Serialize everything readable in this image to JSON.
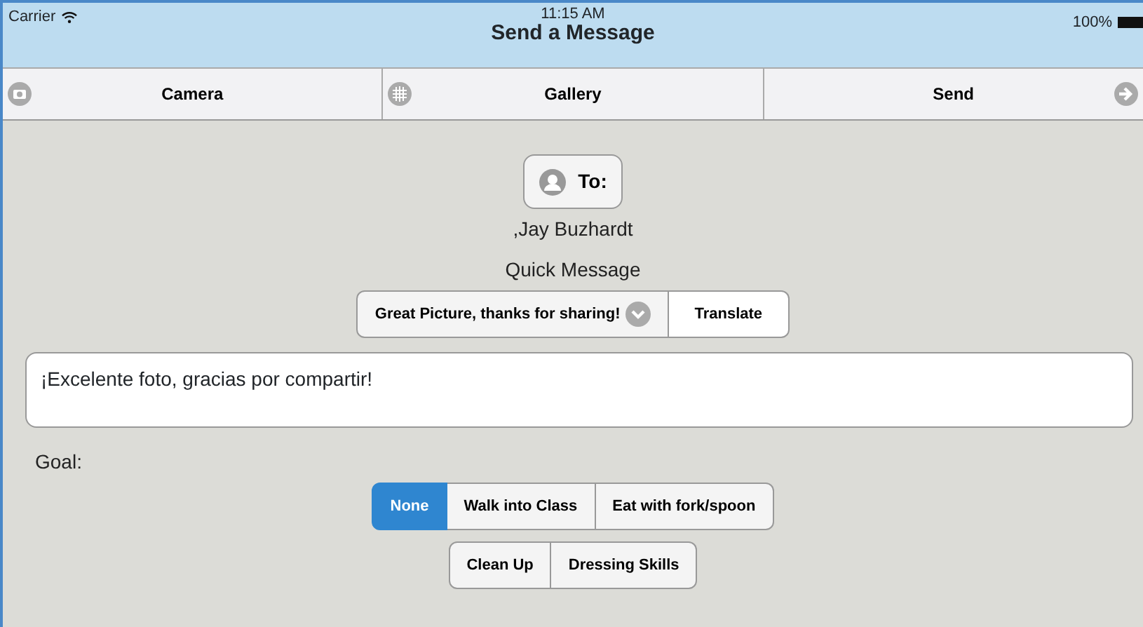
{
  "status_bar": {
    "carrier": "Carrier",
    "time": "11:15 AM",
    "battery": "100%"
  },
  "window": {
    "title": "Send a Message"
  },
  "toolbar": [
    {
      "label": "Camera",
      "kind": "camera"
    },
    {
      "label": "Gallery",
      "kind": "gallery"
    },
    {
      "label": "Send",
      "kind": "send"
    }
  ],
  "recipient": {
    "button": "To:",
    "name": ",Jay Buzhardt"
  },
  "quick_message": {
    "label": "Quick Message",
    "value": "Great Picture, thanks for sharing!",
    "action": "Translate"
  },
  "message": {
    "value": "¡Excelente foto, gracias por compartir!"
  },
  "goal": {
    "label": "Goal:",
    "groups": [
      {
        "options": [
          {
            "label": "None",
            "selected": true
          },
          {
            "label": "Walk into Class",
            "selected": false
          },
          {
            "label": "Eat with fork/spoon",
            "selected": false
          }
        ]
      },
      {
        "options": [
          {
            "label": "Clean Up",
            "selected": false
          },
          {
            "label": "Dressing Skills",
            "selected": false
          }
        ]
      }
    ]
  }
}
